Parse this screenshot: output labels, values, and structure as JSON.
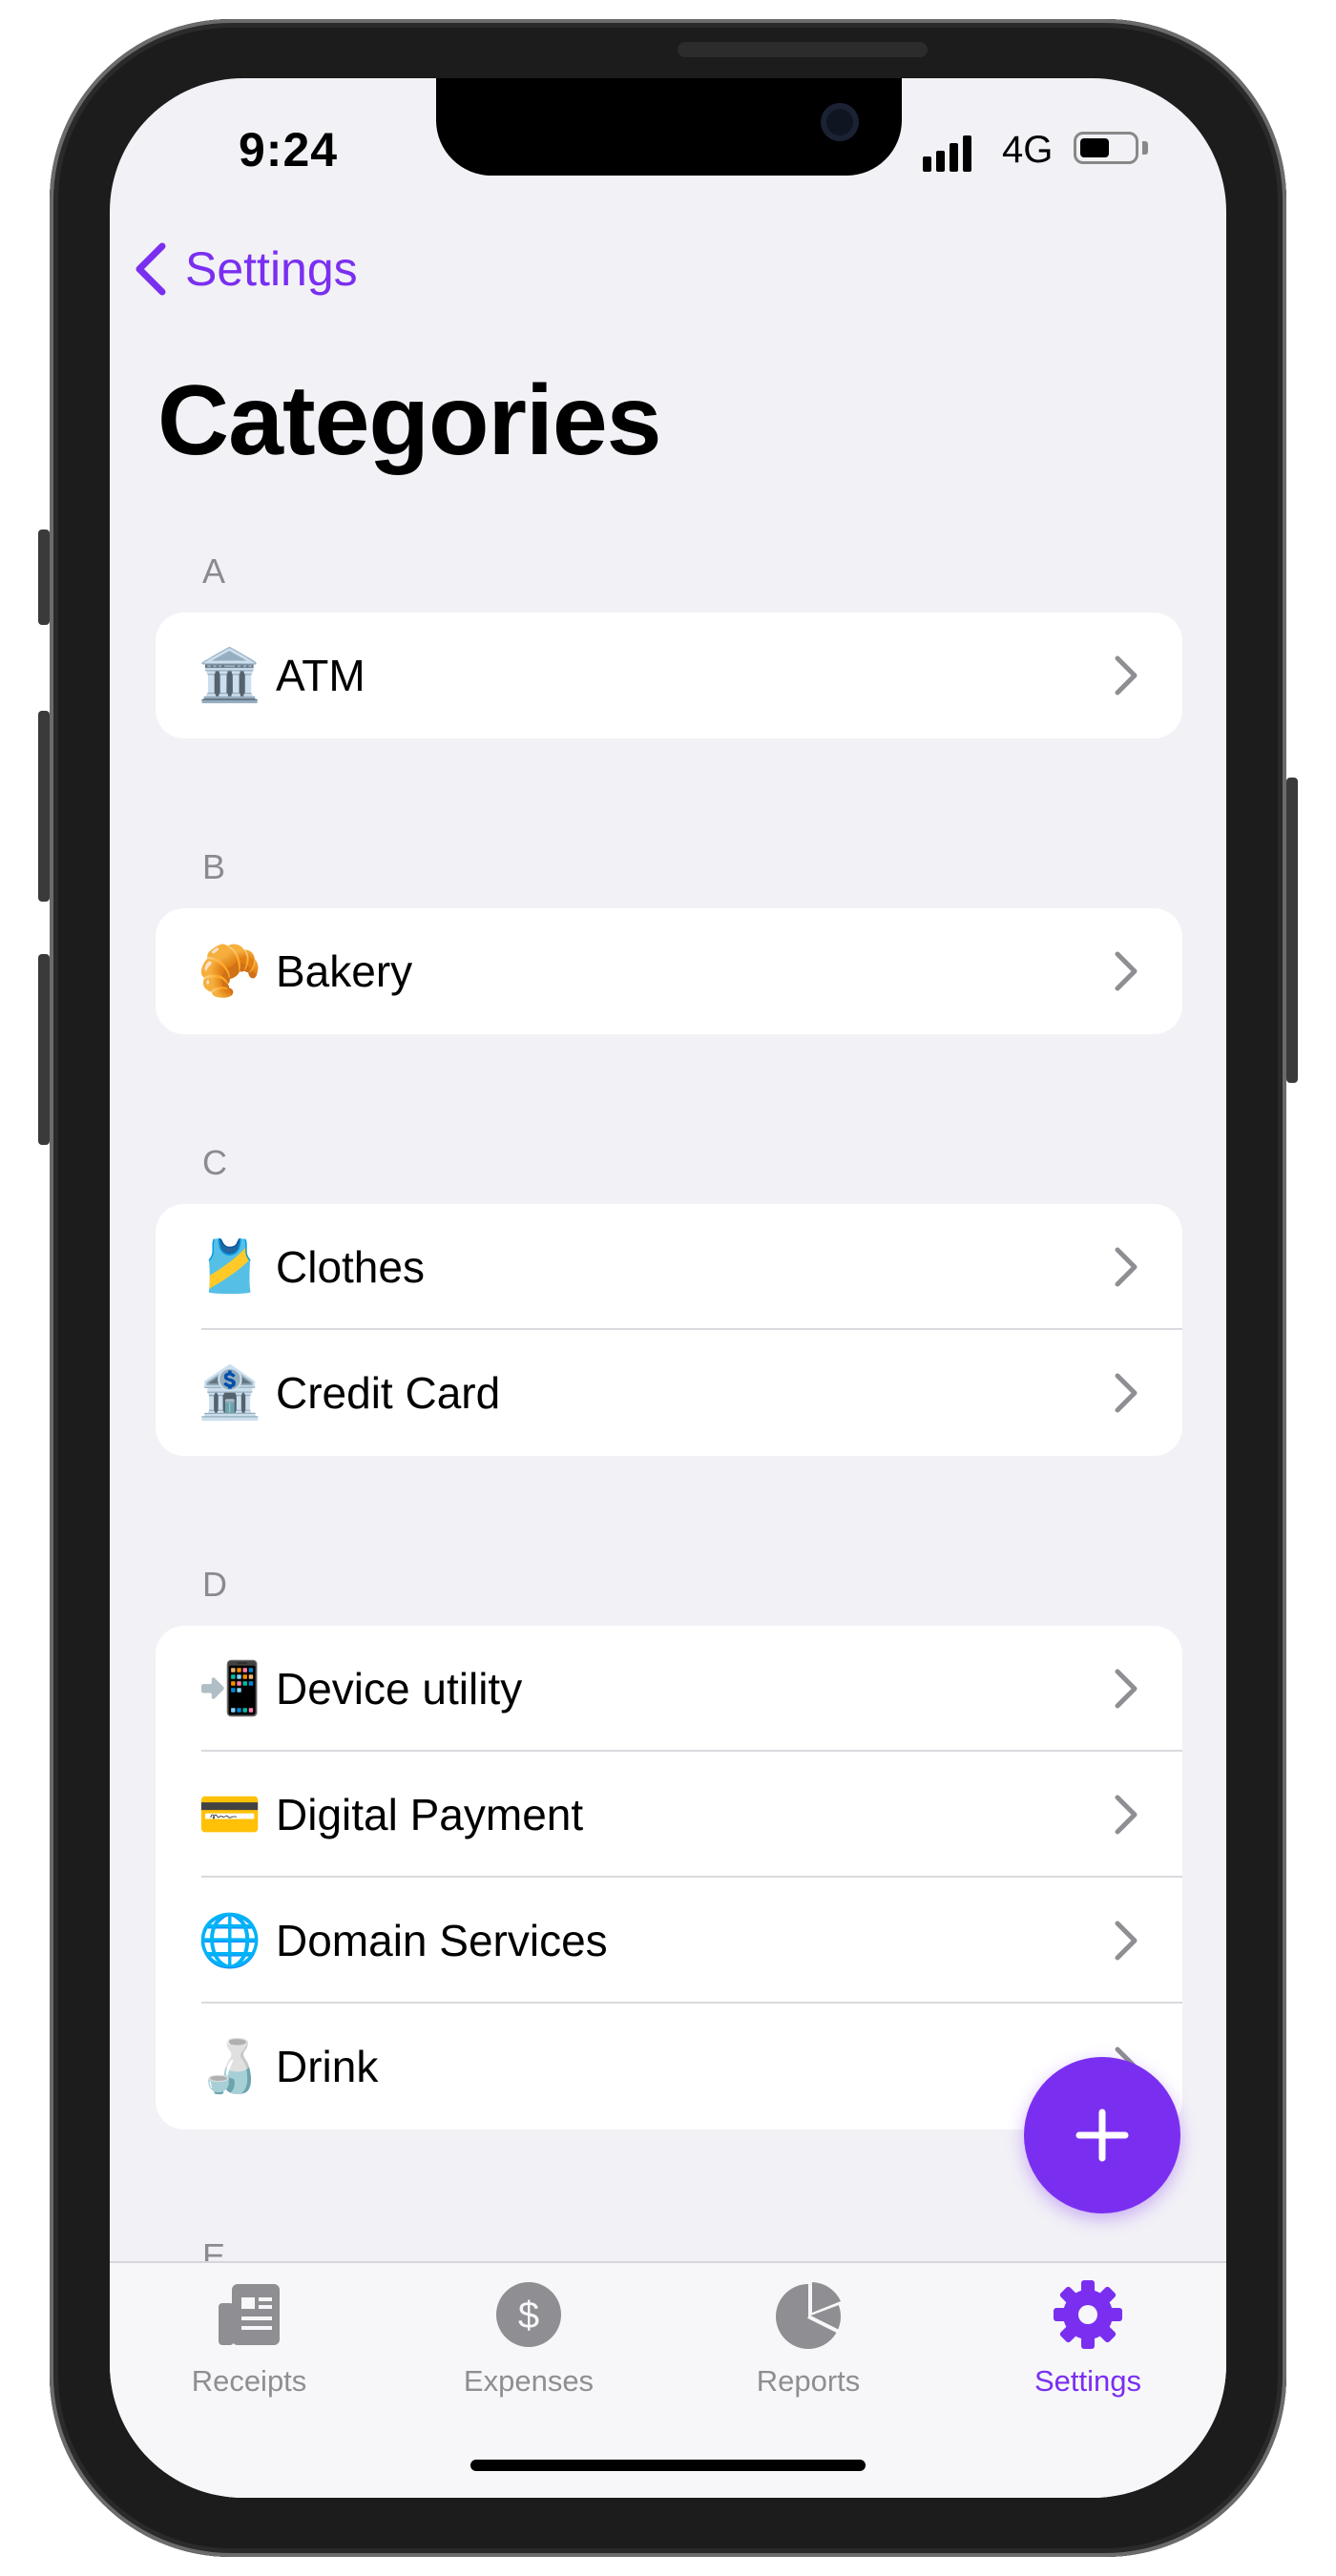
{
  "status_bar": {
    "time": "9:24",
    "network": "4G"
  },
  "nav": {
    "back_label": "Settings",
    "title": "Categories"
  },
  "sections": [
    {
      "header": "A",
      "items": [
        {
          "emoji": "🏛️",
          "label": "ATM"
        }
      ]
    },
    {
      "header": "B",
      "items": [
        {
          "emoji": "🥐",
          "label": "Bakery"
        }
      ]
    },
    {
      "header": "C",
      "items": [
        {
          "emoji": "🎽",
          "label": "Clothes"
        },
        {
          "emoji": "🏦",
          "label": "Credit Card"
        }
      ]
    },
    {
      "header": "D",
      "items": [
        {
          "emoji": "📲",
          "label": "Device utility"
        },
        {
          "emoji": "💳",
          "label": "Digital Payment"
        },
        {
          "emoji": "🌐",
          "label": "Domain Services"
        },
        {
          "emoji": "🍶",
          "label": "Drink"
        }
      ]
    },
    {
      "header": "E",
      "items": []
    }
  ],
  "tabs": [
    {
      "label": "Receipts",
      "icon": "receipt-icon",
      "active": false
    },
    {
      "label": "Expenses",
      "icon": "dollar-icon",
      "active": false
    },
    {
      "label": "Reports",
      "icon": "pie-chart-icon",
      "active": false
    },
    {
      "label": "Settings",
      "icon": "gear-icon",
      "active": true
    }
  ],
  "colors": {
    "accent": "#7a2ff0",
    "inactive": "#8e8e93",
    "background": "#f2f1f6"
  }
}
